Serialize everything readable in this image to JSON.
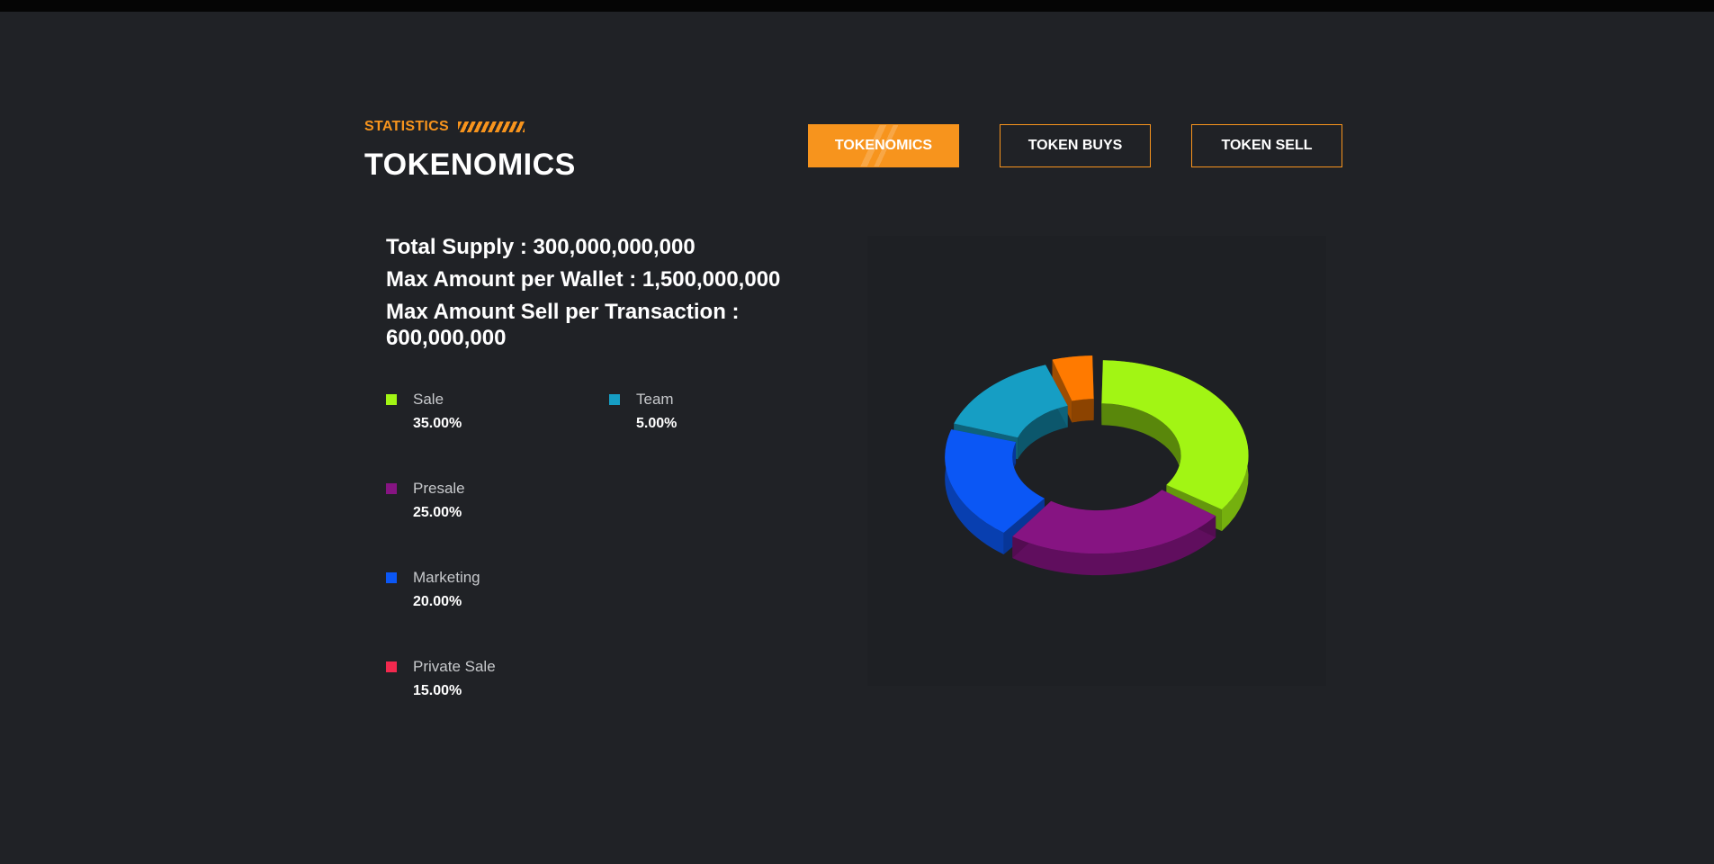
{
  "header": {
    "eyebrow": "STATISTICS",
    "title": "TOKENOMICS"
  },
  "tabs": [
    {
      "label": "TOKENOMICS",
      "active": true
    },
    {
      "label": "TOKEN BUYS",
      "active": false
    },
    {
      "label": "TOKEN SELL",
      "active": false
    }
  ],
  "stats": {
    "total_supply": "Total Supply : 300,000,000,000",
    "max_wallet": "Max Amount per Wallet : 1,500,000,000",
    "max_sell_label": "Max Amount Sell per Transaction :",
    "max_sell_value": "600,000,000"
  },
  "legend": [
    {
      "name": "Sale",
      "pct": "35.00%",
      "color": "#a2f514"
    },
    {
      "name": "Team",
      "pct": "5.00%",
      "color": "#169ec4"
    },
    {
      "name": "Presale",
      "pct": "25.00%",
      "color": "#861482"
    },
    {
      "name": "Marketing",
      "pct": "20.00%",
      "color": "#0b57f5"
    },
    {
      "name": "Private Sale",
      "pct": "15.00%",
      "color": "#f2294e"
    }
  ],
  "colors": {
    "accent": "#f7941d",
    "background": "#202226",
    "chart_panel": "#1e2024"
  },
  "chart_data": {
    "type": "pie",
    "donut": true,
    "style": "3d",
    "slices": [
      {
        "label": "Sale",
        "value": 35,
        "color": "#a2f514"
      },
      {
        "label": "Presale",
        "value": 25,
        "color": "#861482"
      },
      {
        "label": "Marketing",
        "value": 20,
        "color": "#0b57f5"
      },
      {
        "label": "Private Sale",
        "value": 15,
        "color": "#169ec4"
      },
      {
        "label": "Team",
        "value": 5,
        "color": "#ff7a00"
      }
    ]
  }
}
